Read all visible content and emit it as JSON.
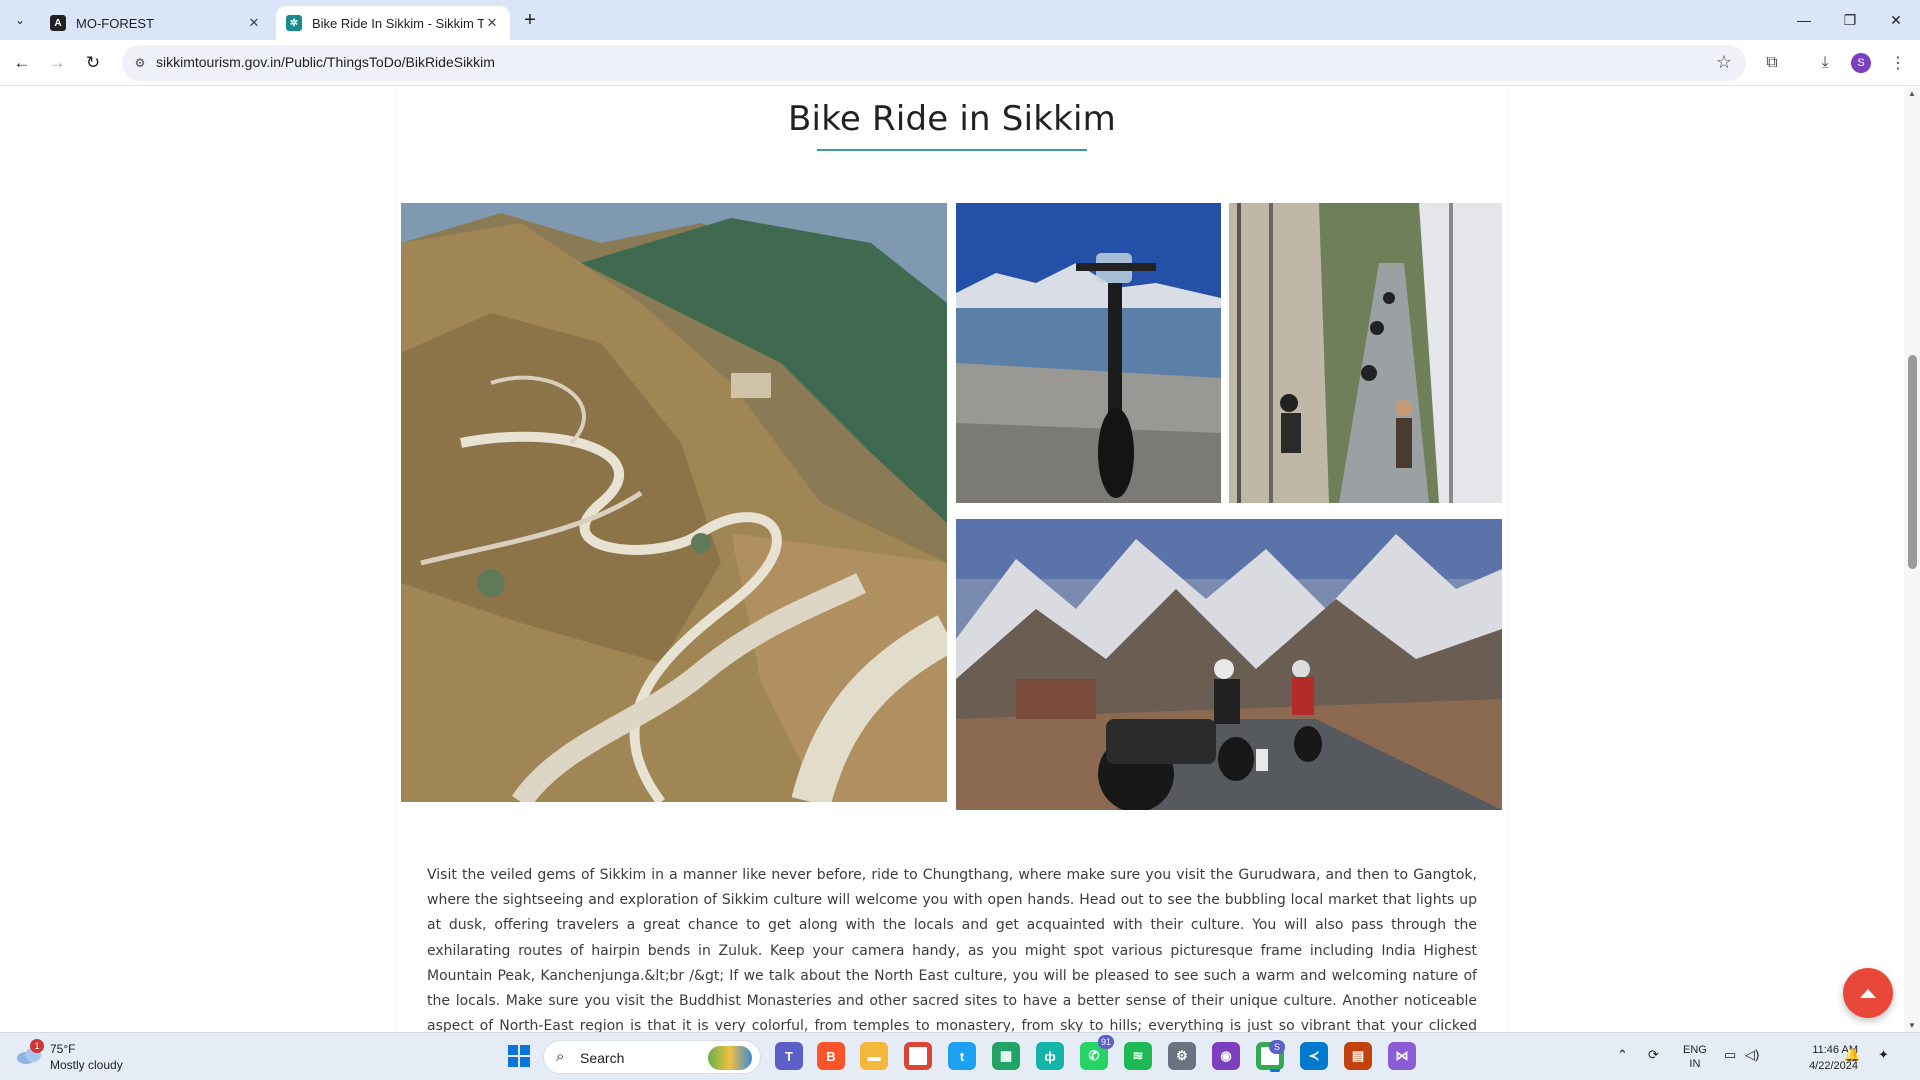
{
  "browser": {
    "tabs": [
      {
        "title": "MO-FOREST",
        "active": false
      },
      {
        "title": "Bike Ride In Sikkim - Sikkim To",
        "active": true
      }
    ],
    "url": "sikkimtourism.gov.in/Public/ThingsToDo/BikRideSikkim",
    "profile_initial": "S"
  },
  "page": {
    "title": "Bike Ride in Sikkim",
    "description": "Visit the veiled gems of Sikkim in a manner like never before, ride to Chungthang, where make sure you visit the Gurudwara, and then to Gangtok, where the sightseeing and exploration of Sikkim culture will welcome you with open hands. Head out to see the bubbling local market that lights up at dusk, offering travelers a great chance to get along with the locals and get acquainted with their culture. You will also pass through the exhilarating routes of hairpin bends in Zuluk. Keep your camera handy, as you might spot various picturesque frame including India Highest Mountain Peak, Kanchenjunga.&lt;br /&gt; If we talk about the North East culture, you will be pleased to see such a warm and welcoming nature of the locals. Make sure you visit the Buddhist Monasteries and other sacred sites to have a better sense of their unique culture. Another noticeable aspect of North-East region is that it is very colorful, from temples to monastery, from sky to hills; everything is just so vibrant that your clicked pictures will be naturally awesome for your Instagram feed. The Sikkim bike trip is a great way to get introduced to popular motorbike tours in India.",
    "accent_color": "#3a9b9b",
    "scroll_top_color": "#e8473a"
  },
  "taskbar": {
    "weather": {
      "temp": "75°F",
      "condition": "Mostly cloudy",
      "badge": "1"
    },
    "search_label": "Search",
    "whatsapp_badge": "91",
    "chrome_badge": "S",
    "language": {
      "line1": "ENG",
      "line2": "IN"
    },
    "time": "11:46 AM",
    "date": "4/22/2024"
  }
}
